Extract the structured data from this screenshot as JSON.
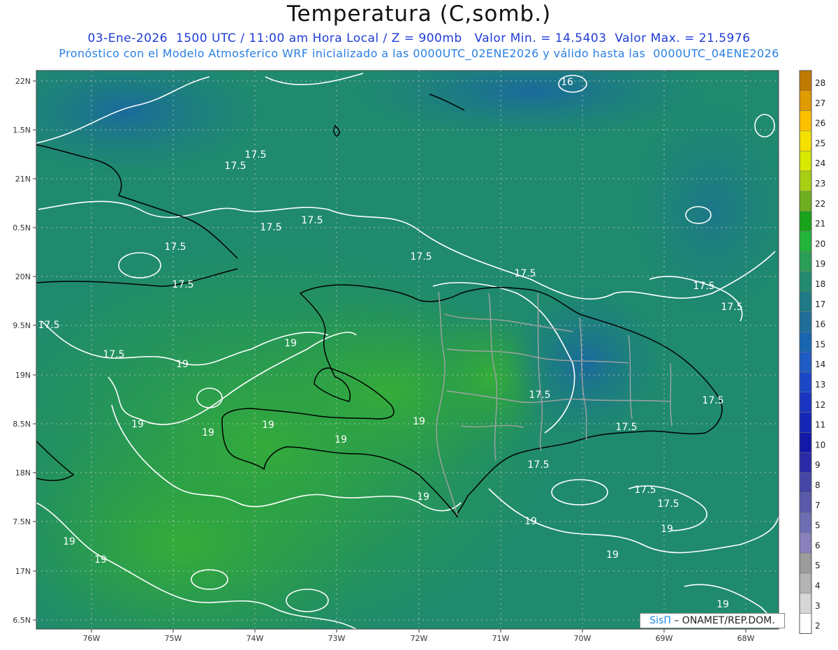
{
  "header": {
    "title": "Temperatura (C,somb.)",
    "line1": "03-Ene-2026  1500 UTC / 11:00 am Hora Local / Z = 900mb   Valor Min. = 14.5403  Valor Max. = 21.5976",
    "line2": "Pronóstico con el Modelo Atmosferico WRF inicializado a las 0000UTC_02ENE2026 y válido hasta las  0000UTC_04ENE2026"
  },
  "map": {
    "lat_labels": [
      "22N",
      "1.5N",
      "21N",
      "0.5N",
      "20N",
      "9.5N",
      "19N",
      "8.5N",
      "18N",
      "7.5N",
      "17N",
      "6.5N"
    ],
    "lon_labels": [
      "76W",
      "75W",
      "74W",
      "73W",
      "72W",
      "71W",
      "70W",
      "69W",
      "68W"
    ],
    "contour_labels": [
      "16",
      "17.5",
      "17.5",
      "17.5",
      "17.5",
      "17.5",
      "17.5",
      "17.5",
      "17.5",
      "17.5",
      "17.5",
      "17.5",
      "17.5",
      "17.5",
      "17.5",
      "17.5",
      "17.5",
      "17.5",
      "17.5",
      "19",
      "19",
      "19",
      "19",
      "19",
      "19",
      "19",
      "19",
      "19",
      "19",
      "19",
      "19",
      "19",
      "19"
    ],
    "colors": {
      "ocean": "#1f8a6e",
      "land_warm": "#2fa33c",
      "cool": "#1a6fa0",
      "contour": "#ffffff",
      "border": "#9a9a9a",
      "coast": "#000000"
    }
  },
  "colorbar": {
    "labels": [
      "28",
      "27",
      "26",
      "25",
      "24",
      "23",
      "22",
      "21",
      "20",
      "19",
      "18",
      "17",
      "16",
      "15",
      "14",
      "13",
      "12",
      "11",
      "10",
      "9",
      "8",
      "7",
      "5",
      "6",
      "5",
      "4",
      "3",
      "2"
    ],
    "colors": [
      "#c07a00",
      "#e09b00",
      "#ffc000",
      "#f5e000",
      "#d8e800",
      "#a8cf14",
      "#6fae1e",
      "#19a31a",
      "#22b43b",
      "#2a9e57",
      "#228a6e",
      "#1e7a86",
      "#1e6e98",
      "#1866b0",
      "#1f5bc4",
      "#1c48c8",
      "#1a35c0",
      "#1526b4",
      "#1218a8",
      "#2a2aa8",
      "#4646a8",
      "#5a5aaa",
      "#6e6eb4",
      "#8a80bc",
      "#9c9c9c",
      "#b4b4b4",
      "#d6d6d6",
      "#ffffff"
    ]
  },
  "credit": {
    "brand": "SisΠ",
    "text": "– ONAMET/REP.DOM."
  }
}
